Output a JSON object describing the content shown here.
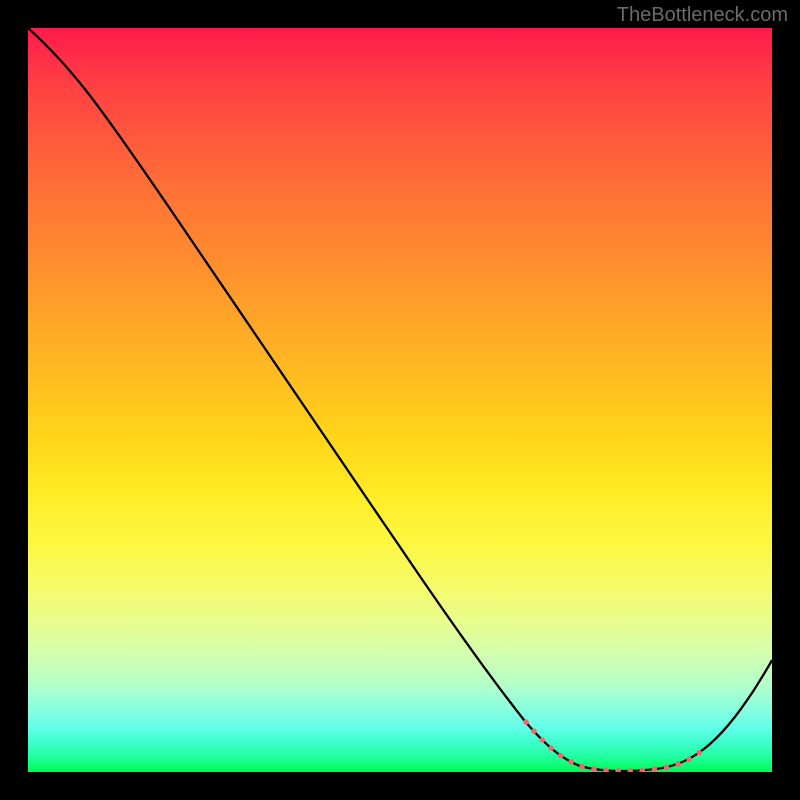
{
  "watermark": "TheBottleneck.com",
  "chart_data": {
    "type": "line",
    "x": [
      0,
      0.04,
      0.08,
      0.12,
      0.16,
      0.2,
      0.24,
      0.28,
      0.32,
      0.36,
      0.4,
      0.44,
      0.48,
      0.52,
      0.56,
      0.6,
      0.64,
      0.68,
      0.72,
      0.76,
      0.8,
      0.84,
      0.88,
      0.92,
      0.96,
      1.0
    ],
    "values": [
      1.0,
      0.955,
      0.905,
      0.848,
      0.79,
      0.732,
      0.674,
      0.616,
      0.558,
      0.5,
      0.442,
      0.384,
      0.326,
      0.268,
      0.21,
      0.152,
      0.098,
      0.055,
      0.024,
      0.008,
      0.002,
      0.002,
      0.008,
      0.028,
      0.062,
      0.11
    ],
    "dotted_range": {
      "start": 0.67,
      "end": 0.9
    },
    "title": "",
    "xlabel": "",
    "ylabel": "",
    "xlim": [
      0,
      1
    ],
    "ylim": [
      0,
      1
    ]
  }
}
